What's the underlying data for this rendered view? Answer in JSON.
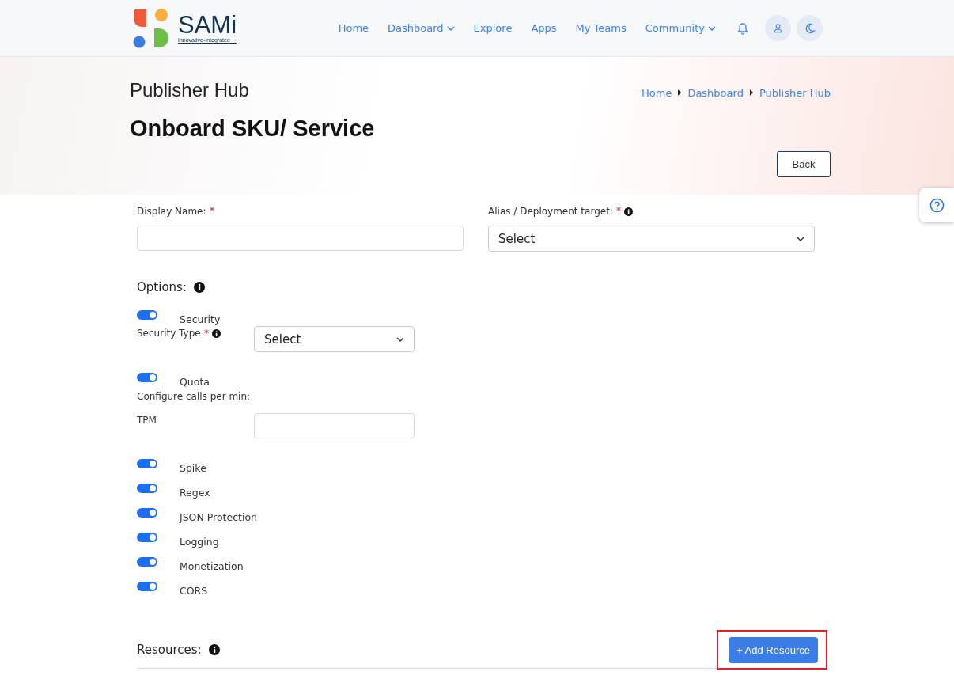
{
  "brand": {
    "name": "SAMi",
    "tagline": "Innovative-Integrated"
  },
  "nav": [
    {
      "label": "Home",
      "dropdown": false
    },
    {
      "label": "Dashboard",
      "dropdown": true
    },
    {
      "label": "Explore",
      "dropdown": false
    },
    {
      "label": "Apps",
      "dropdown": false
    },
    {
      "label": "My Teams",
      "dropdown": false
    },
    {
      "label": "Community",
      "dropdown": true
    }
  ],
  "page_title": "Publisher Hub",
  "breadcrumb": [
    "Home",
    "Dashboard",
    "Publisher Hub"
  ],
  "heading": "Onboard SKU/ Service",
  "back_button": "Back",
  "fields": [
    {
      "kind": "input",
      "label": "Display Name:",
      "required": true,
      "info": false
    },
    {
      "kind": "select",
      "label": "Alias / Deployment target:",
      "required": true,
      "info": true,
      "placeholder": "Select"
    }
  ],
  "options": {
    "title": "Options:",
    "items": [
      {
        "kind": "toggle",
        "label": "Security",
        "on": true
      },
      {
        "kind": "select",
        "label": "Security Type",
        "required": true,
        "placeholder": "Select"
      },
      {
        "kind": "toggle",
        "label": "Quota",
        "on": true
      },
      {
        "kind": "note",
        "label": "Configure calls per min:"
      },
      {
        "kind": "input",
        "label": "TPM"
      },
      {
        "kind": "toggle",
        "label": "Spike",
        "on": true
      },
      {
        "kind": "toggle",
        "label": "Regex",
        "on": true
      },
      {
        "kind": "toggle",
        "label": "JSON Protection",
        "on": true
      },
      {
        "kind": "toggle",
        "label": "Logging",
        "on": true
      },
      {
        "kind": "toggle",
        "label": "Monetization",
        "on": true
      },
      {
        "kind": "toggle",
        "label": "CORS",
        "on": true
      }
    ]
  },
  "resources": {
    "title": "Resources:",
    "add_button": "+ Add Resource",
    "highlighted": true
  }
}
